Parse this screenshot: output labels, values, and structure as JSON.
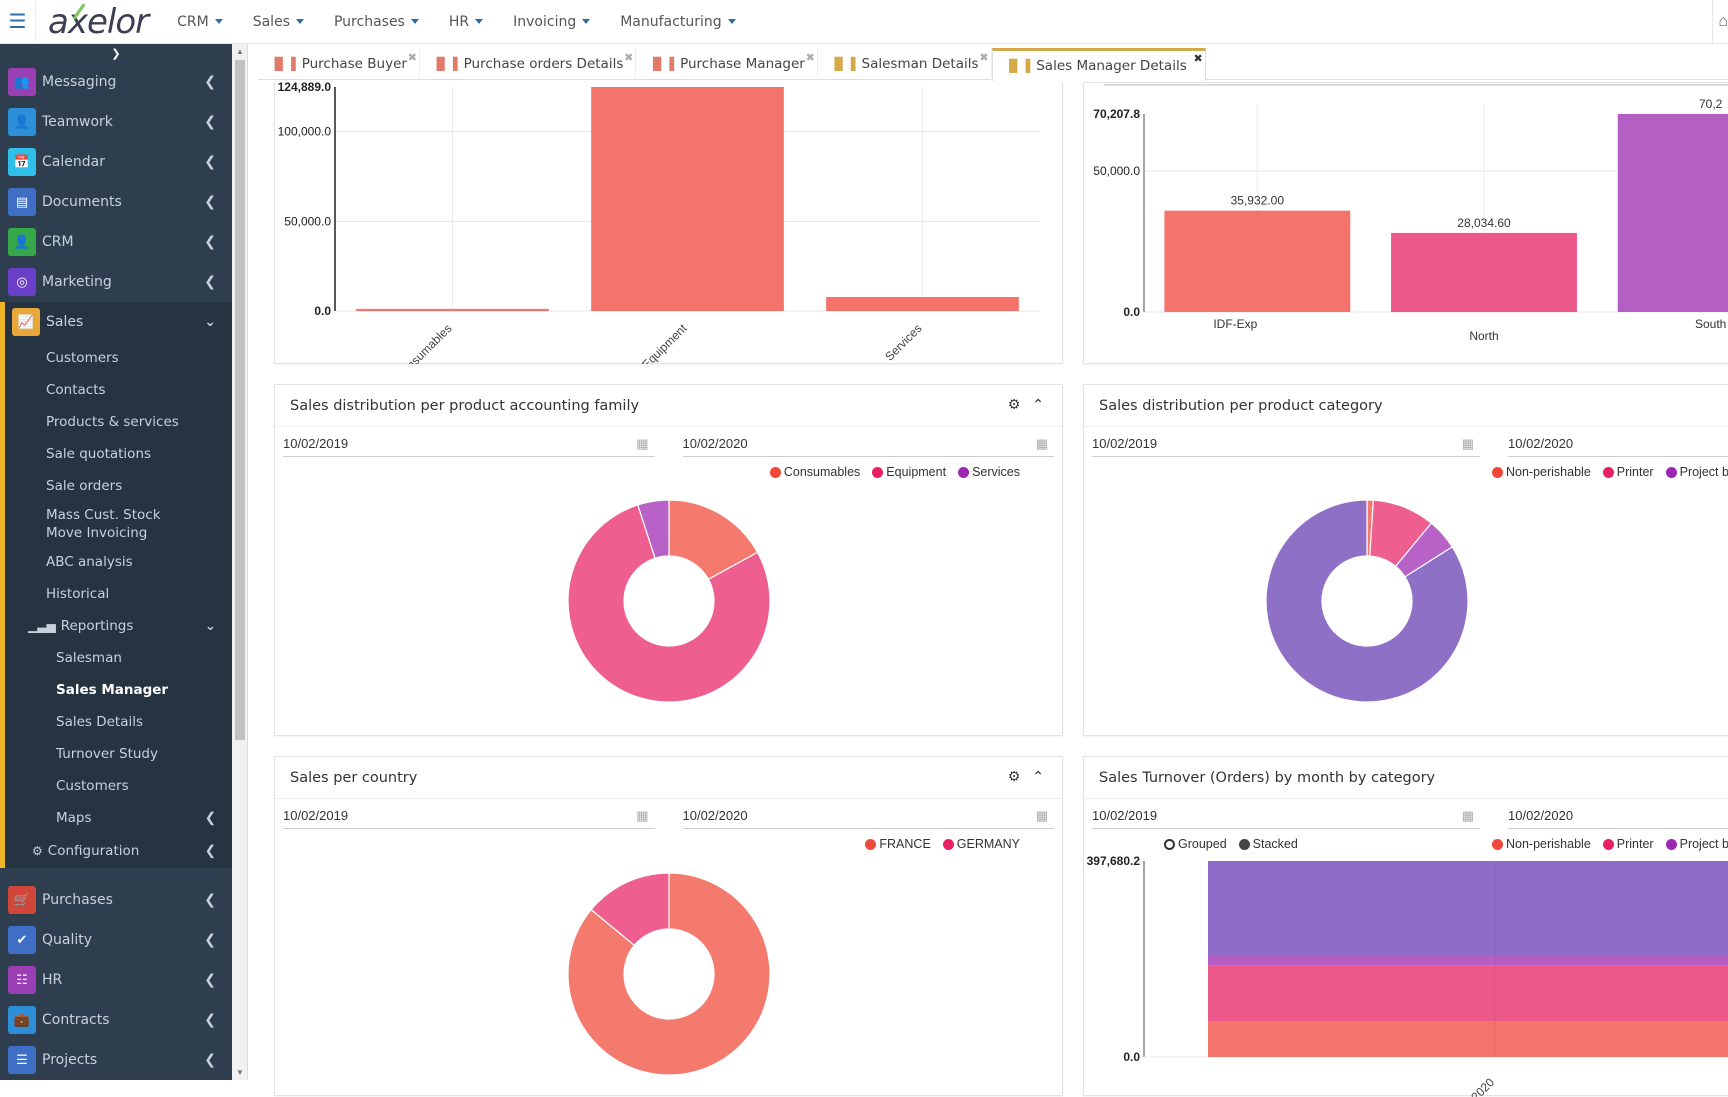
{
  "app": {
    "logo": "axelor",
    "topnav": [
      "CRM",
      "Sales",
      "Purchases",
      "HR",
      "Invoicing",
      "Manufacturing"
    ]
  },
  "sidebar": {
    "top_items": [
      {
        "label": "Messaging",
        "icon": "users-icon",
        "color": "#9b3fb5"
      },
      {
        "label": "Teamwork",
        "icon": "user-icon",
        "color": "#2d8fd8"
      },
      {
        "label": "Calendar",
        "icon": "calendar-icon",
        "color": "#2ec0e8"
      },
      {
        "label": "Documents",
        "icon": "archive-icon",
        "color": "#3f6fc4"
      },
      {
        "label": "CRM",
        "icon": "user-icon",
        "color": "#37a84a"
      },
      {
        "label": "Marketing",
        "icon": "target-icon",
        "color": "#6a3fc9"
      }
    ],
    "sales": {
      "label": "Sales",
      "color": "#e8a93a",
      "items": [
        "Customers",
        "Contacts",
        "Products & services",
        "Sale quotations",
        "Sale orders",
        "Mass Cust. Stock Move Invoicing",
        "ABC analysis",
        "Historical"
      ],
      "reportings": {
        "label": "Reportings",
        "items": [
          "Salesman",
          "Sales Manager",
          "Sales Details",
          "Turnover Study",
          "Customers",
          "Maps"
        ],
        "active": "Sales Manager"
      },
      "configuration": "Configuration"
    },
    "bottom_items": [
      {
        "label": "Purchases",
        "icon": "cart-icon",
        "color": "#d0473a"
      },
      {
        "label": "Quality",
        "icon": "check-icon",
        "color": "#3f6fc4"
      },
      {
        "label": "HR",
        "icon": "sitemap-icon",
        "color": "#9b3fb5"
      },
      {
        "label": "Contracts",
        "icon": "briefcase-icon",
        "color": "#2d8fd8"
      },
      {
        "label": "Projects",
        "icon": "tasks-icon",
        "color": "#3f6fc4"
      }
    ]
  },
  "tabs": [
    {
      "label": "Purchase Buyer"
    },
    {
      "label": "Purchase orders Details"
    },
    {
      "label": "Purchase Manager"
    },
    {
      "label": "Salesman Details"
    },
    {
      "label": "Sales Manager Details",
      "active": true
    }
  ],
  "panels": {
    "family_bar": {
      "title": ""
    },
    "region_bar": {
      "title": ""
    },
    "family_pie": {
      "title": "Sales distribution per product accounting family",
      "date_from": "10/02/2019",
      "date_to": "10/02/2020"
    },
    "category_pie": {
      "title": "Sales distribution per product category",
      "date_from": "10/02/2019",
      "date_to": "10/02/2020"
    },
    "country_pie": {
      "title": "Sales per country",
      "date_from": "10/02/2019",
      "date_to": "10/02/2020"
    },
    "turnover": {
      "title": "Sales Turnover (Orders) by month by category",
      "date_from": "10/02/2019",
      "date_to": "10/02/2020",
      "mode_grouped": "Grouped",
      "mode_stacked": "Stacked"
    }
  },
  "chart_data": [
    {
      "id": "family_bar",
      "type": "bar",
      "categories": [
        "Consumables",
        "Equipment",
        "Services"
      ],
      "values": [
        1200,
        124889,
        7800
      ],
      "ylim": [
        0,
        124889
      ],
      "yticks": [
        "0.0",
        "50,000.0",
        "100,000.0",
        "124,889.0"
      ],
      "ytick_values": [
        0,
        50000,
        100000,
        124889
      ],
      "color": "#f4736a",
      "grid": true
    },
    {
      "id": "region_bar",
      "type": "bar",
      "categories": [
        "IDF-Exp",
        "North",
        "South"
      ],
      "values": [
        35932.0,
        28034.6,
        70207.8
      ],
      "labels": [
        "35,932.00",
        "28,034.60",
        "70,2"
      ],
      "ylim": [
        0,
        70207.8
      ],
      "yticks": [
        "0.0",
        "50,000.0",
        "70,207.8"
      ],
      "ytick_values": [
        0,
        50000,
        70207.8
      ],
      "colors": [
        "#f4736a",
        "#ec588a",
        "#b55ec4"
      ],
      "grid": true
    },
    {
      "id": "family_pie",
      "type": "pie",
      "labels": [
        "Consumables",
        "Equipment",
        "Services"
      ],
      "values": [
        17,
        78,
        5
      ],
      "colors": [
        "#f47a6e",
        "#ee5e8e",
        "#b862c8"
      ],
      "legend_colors": [
        "#f0483a",
        "#e91e63",
        "#9c27b0"
      ],
      "legend": "top-right"
    },
    {
      "id": "category_pie",
      "type": "pie",
      "labels": [
        "Non-perishable",
        "Printer",
        "Project b",
        ""
      ],
      "values": [
        1,
        10,
        5,
        84
      ],
      "colors": [
        "#f47a6e",
        "#ee5e8e",
        "#b862c8",
        "#8e71c7"
      ],
      "legend_colors": [
        "#f0483a",
        "#e91e63",
        "#9c27b0"
      ],
      "legend": "top-right"
    },
    {
      "id": "country_pie",
      "type": "pie",
      "labels": [
        "FRANCE",
        "GERMANY"
      ],
      "values": [
        86,
        14
      ],
      "colors": [
        "#f47a6e",
        "#ee5e8e"
      ],
      "legend_colors": [
        "#f0483a",
        "#e91e63"
      ],
      "legend": "top-right"
    },
    {
      "id": "turnover",
      "type": "bar",
      "stacked": true,
      "categories": [
        "2020"
      ],
      "series": [
        {
          "name": "Non-perishable",
          "values": [
            73000
          ],
          "color": "#f4736a"
        },
        {
          "name": "Printer",
          "values": [
            113000
          ],
          "color": "#ec588a"
        },
        {
          "name": "Project b",
          "values": [
            20000
          ],
          "color": "#b55ec4"
        },
        {
          "name": "",
          "values": [
            191680.2
          ],
          "color": "#8e6cc7"
        }
      ],
      "ylim": [
        0,
        397680.2
      ],
      "yticks": [
        "0.0",
        "397,680.2"
      ],
      "ytick_values": [
        0,
        397680.2
      ]
    }
  ]
}
